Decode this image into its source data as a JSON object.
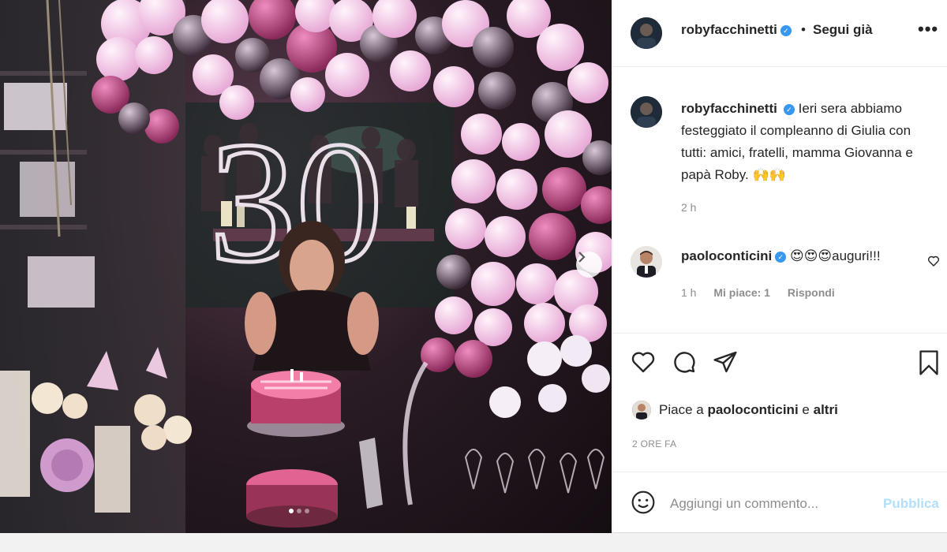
{
  "post": {
    "author": {
      "username": "robyfacchinetti",
      "follow_status": "Segui già",
      "more_icon": "more-horizontal-icon"
    },
    "caption": {
      "username": "robyfacchinetti",
      "text": "Ieri sera abbiamo festeggiato il compleanno di Giulia con tutti: amici, fratelli, mamma Giovanna e papà Roby.",
      "emojis": "🙌🙌",
      "time": "2 h"
    },
    "photo": {
      "cake_number": "30",
      "carousel_total": 3,
      "carousel_active": 1
    },
    "comments": [
      {
        "username": "paoloconticini",
        "text": "😍😍😍auguri!!!",
        "time": "1 h",
        "likes": "Mi piace: 1",
        "reply": "Rispondi"
      }
    ],
    "likes": {
      "prefix": "Piace a ",
      "user": "paoloconticini",
      "connector": " e ",
      "others": "altri"
    },
    "date": "2 ORE FA",
    "comment_box": {
      "placeholder": "Aggiungi un commento...",
      "publish": "Pubblica"
    },
    "colors": {
      "verified": "#3897f0",
      "publish_disabled": "#b2dffc",
      "meta_gray": "#8e8e8e"
    }
  }
}
